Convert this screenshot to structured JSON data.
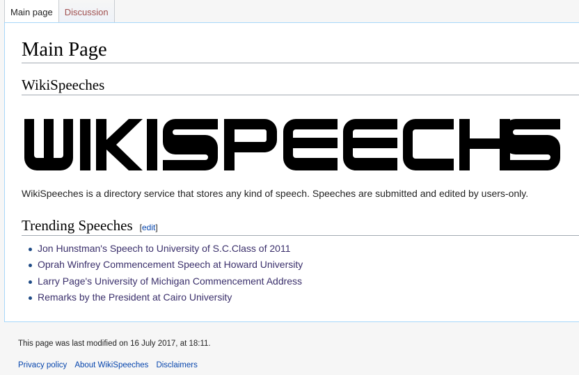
{
  "tabs": [
    {
      "label": "Main page"
    },
    {
      "label": "Discussion"
    }
  ],
  "page_title": "Main Page",
  "site_heading": "WikiSpeeches",
  "logo_text": "WIKISPEECHES",
  "description": "WikiSpeeches is a directory service that stores any kind of speech. Speeches are submitted and edited by users-only.",
  "trending": {
    "heading": "Trending Speeches",
    "edit_open": "[",
    "edit_label": "edit",
    "edit_close": "]",
    "items": [
      {
        "label": "Jon Hunstman's Speech to University of S.C.Class of 2011"
      },
      {
        "label": "Oprah Winfrey Commencement Speech at Howard University"
      },
      {
        "label": "Larry Page's University of Michigan Commencement Address"
      },
      {
        "label": "Remarks by the President at Cairo University"
      }
    ]
  },
  "footer": {
    "last_modified": "This page was last modified on 16 July 2017, at 18:11.",
    "links": [
      {
        "label": "Privacy policy"
      },
      {
        "label": "About WikiSpeeches"
      },
      {
        "label": "Disclaimers"
      }
    ]
  },
  "colors": {
    "link": "#0645ad",
    "visited_link": "#3a2f6b",
    "panel_border": "#a7d7f9"
  }
}
